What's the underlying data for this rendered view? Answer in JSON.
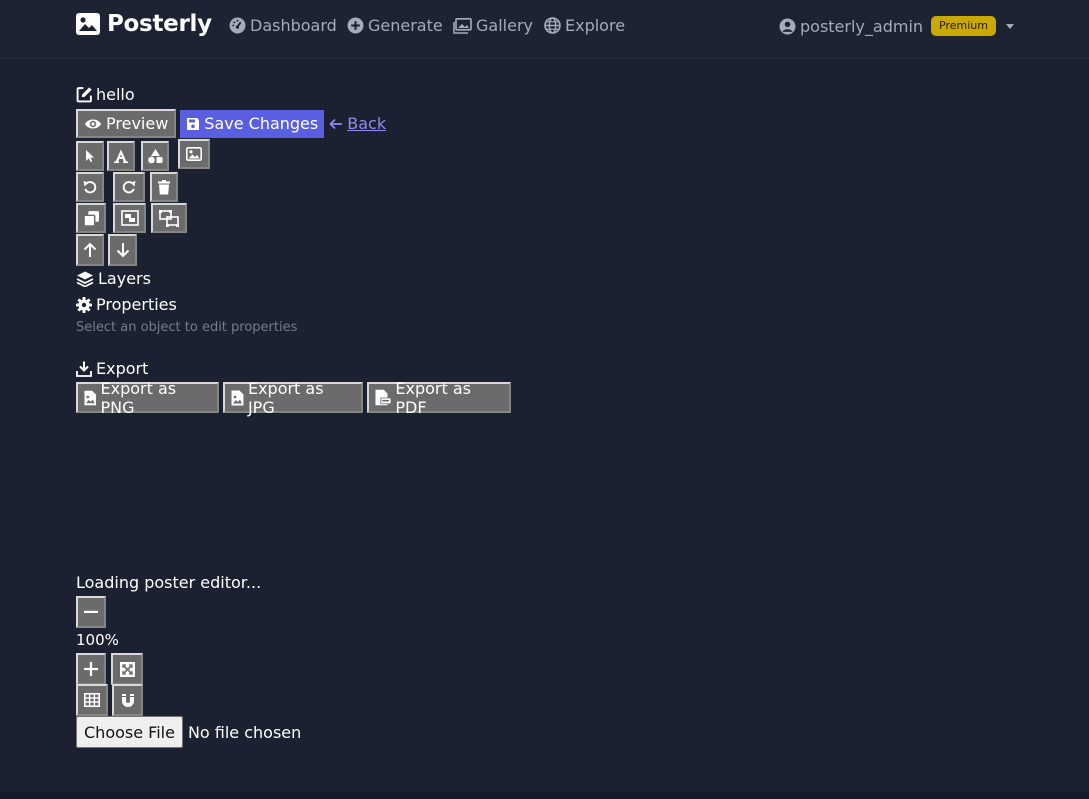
{
  "nav": {
    "brand": "Posterly",
    "links": [
      "Dashboard",
      "Generate",
      "Gallery",
      "Explore"
    ],
    "user": "posterly_admin",
    "badge": "Premium"
  },
  "editor": {
    "title": "hello",
    "preview_label": "Preview",
    "save_label": "Save Changes",
    "back_label": "Back",
    "tool_icons": [
      "select-pointer-icon",
      "text-icon",
      "shapes-icon",
      "image-icon",
      "undo-icon",
      "redo-icon",
      "delete-icon",
      "duplicate-icon",
      "group-icon",
      "ungroup-icon",
      "bring-forward-icon",
      "send-backward-icon"
    ]
  },
  "panels": {
    "layers": "Layers",
    "properties": "Properties",
    "properties_hint": "Select an object to edit properties",
    "export": "Export"
  },
  "export": {
    "png_label": "Export as PNG",
    "jpg_label": "Export as JPG",
    "pdf_label": "Export as PDF"
  },
  "canvas": {
    "loading_text": "Loading poster editor...",
    "zoom_level": "100%"
  },
  "file_input": {
    "button_label": "Choose File",
    "status": "No file chosen"
  },
  "colors": {
    "background": "#1b2131",
    "accent": "#5a5ee0",
    "premium": "#c9a800",
    "link": "#8f8cf0"
  }
}
